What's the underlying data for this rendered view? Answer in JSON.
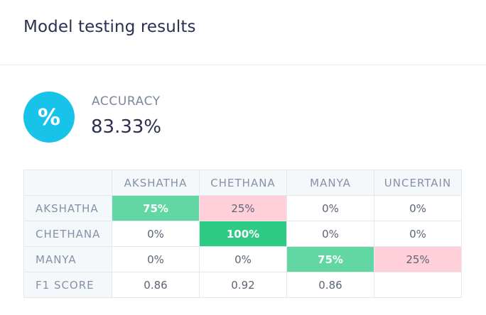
{
  "header": {
    "title": "Model testing results"
  },
  "accuracy": {
    "icon": "percent-icon",
    "icon_glyph": "%",
    "label": "ACCURACY",
    "value": "83.33%",
    "color": "#17c3e8"
  },
  "matrix": {
    "columns": [
      "AKSHATHA",
      "CHETHANA",
      "MANYA",
      "UNCERTAIN"
    ],
    "rows": [
      {
        "label": "AKSHATHA",
        "cells": [
          "75%",
          "25%",
          "0%",
          "0%"
        ]
      },
      {
        "label": "CHETHANA",
        "cells": [
          "0%",
          "100%",
          "0%",
          "0%"
        ]
      },
      {
        "label": "MANYA",
        "cells": [
          "0%",
          "0%",
          "75%",
          "25%"
        ]
      }
    ],
    "f1": {
      "label": "F1 SCORE",
      "cells": [
        "0.86",
        "0.92",
        "0.86",
        ""
      ]
    },
    "colors": {
      "correct_high": "#2ecb85",
      "correct": "#62d7a3",
      "error": "#ffd0da"
    }
  }
}
